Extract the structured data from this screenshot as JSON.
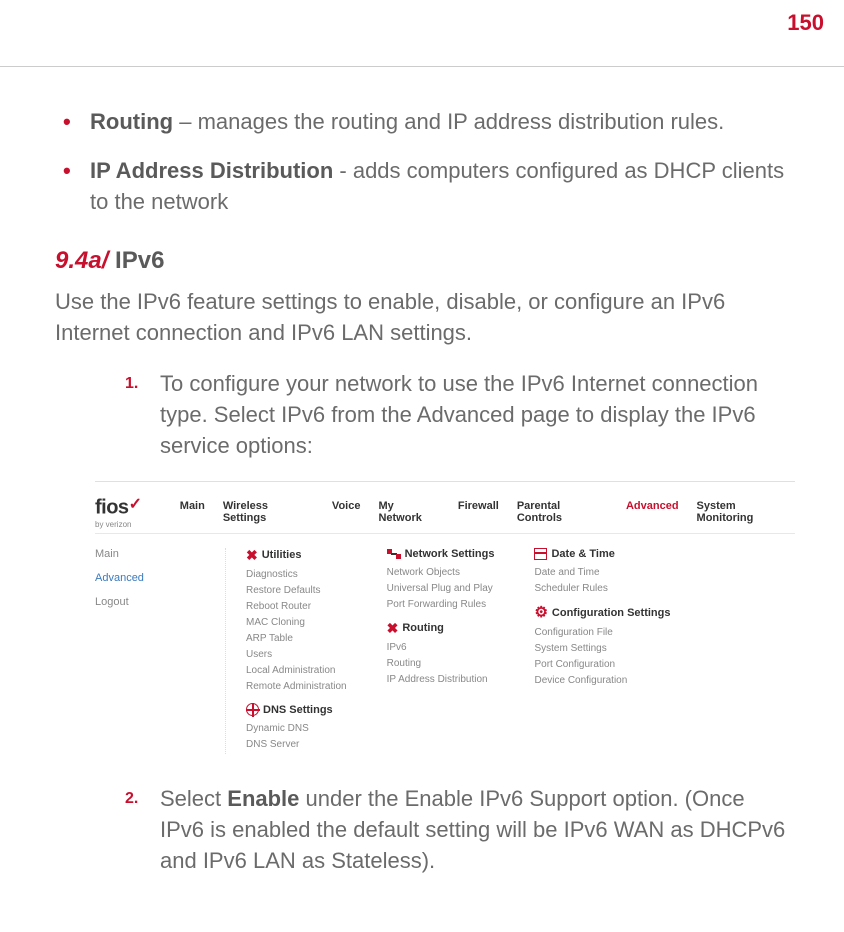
{
  "page_number": "150",
  "bullets": [
    {
      "term": "Routing",
      "sep": " – ",
      "desc": "manages the routing and IP address distribution rules."
    },
    {
      "term": "IP Address Distribution",
      "sep": " - ",
      "desc": "adds computers configured as DHCP clients to the network"
    }
  ],
  "section": {
    "num": "9.4a/",
    "title": " IPv6"
  },
  "intro": "Use the IPv6 feature settings to enable, disable, or configure an IPv6 Internet connection and IPv6 LAN settings.",
  "steps": {
    "1": "To configure your network to use the IPv6 Internet connection type. Select IPv6 from the Advanced page to display the IPv6 service options:",
    "2_prefix": "Select ",
    "2_bold": "Enable",
    "2_suffix": " under the Enable IPv6 Support option. (Once IPv6 is enabled the default setting will be IPv6 WAN as DHCPv6 and IPv6 LAN as Stateless)."
  },
  "screenshot": {
    "logo": {
      "brand": "fios",
      "byline": "by verizon"
    },
    "topnav": [
      "Main",
      "Wireless Settings",
      "Voice",
      "My Network",
      "Firewall",
      "Parental Controls",
      "Advanced",
      "System Monitoring"
    ],
    "topnav_active": "Advanced",
    "sidebar": {
      "items": [
        "Main",
        "Advanced",
        "Logout"
      ],
      "active": "Advanced"
    },
    "columns": {
      "utilities": {
        "title": "Utilities",
        "items": [
          "Diagnostics",
          "Restore Defaults",
          "Reboot Router",
          "MAC Cloning",
          "ARP Table",
          "Users",
          "Local Administration",
          "Remote Administration"
        ]
      },
      "dns": {
        "title": "DNS Settings",
        "items": [
          "Dynamic DNS",
          "DNS Server"
        ]
      },
      "network": {
        "title": "Network Settings",
        "items": [
          "Network Objects",
          "Universal Plug and Play",
          "Port Forwarding Rules"
        ]
      },
      "routing": {
        "title": "Routing",
        "items": [
          "IPv6",
          "Routing",
          "IP Address Distribution"
        ]
      },
      "datetime": {
        "title": "Date & Time",
        "items": [
          "Date and Time",
          "Scheduler Rules"
        ]
      },
      "config": {
        "title": "Configuration Settings",
        "items": [
          "Configuration File",
          "System Settings",
          "Port Configuration",
          "Device Configuration"
        ]
      }
    }
  }
}
